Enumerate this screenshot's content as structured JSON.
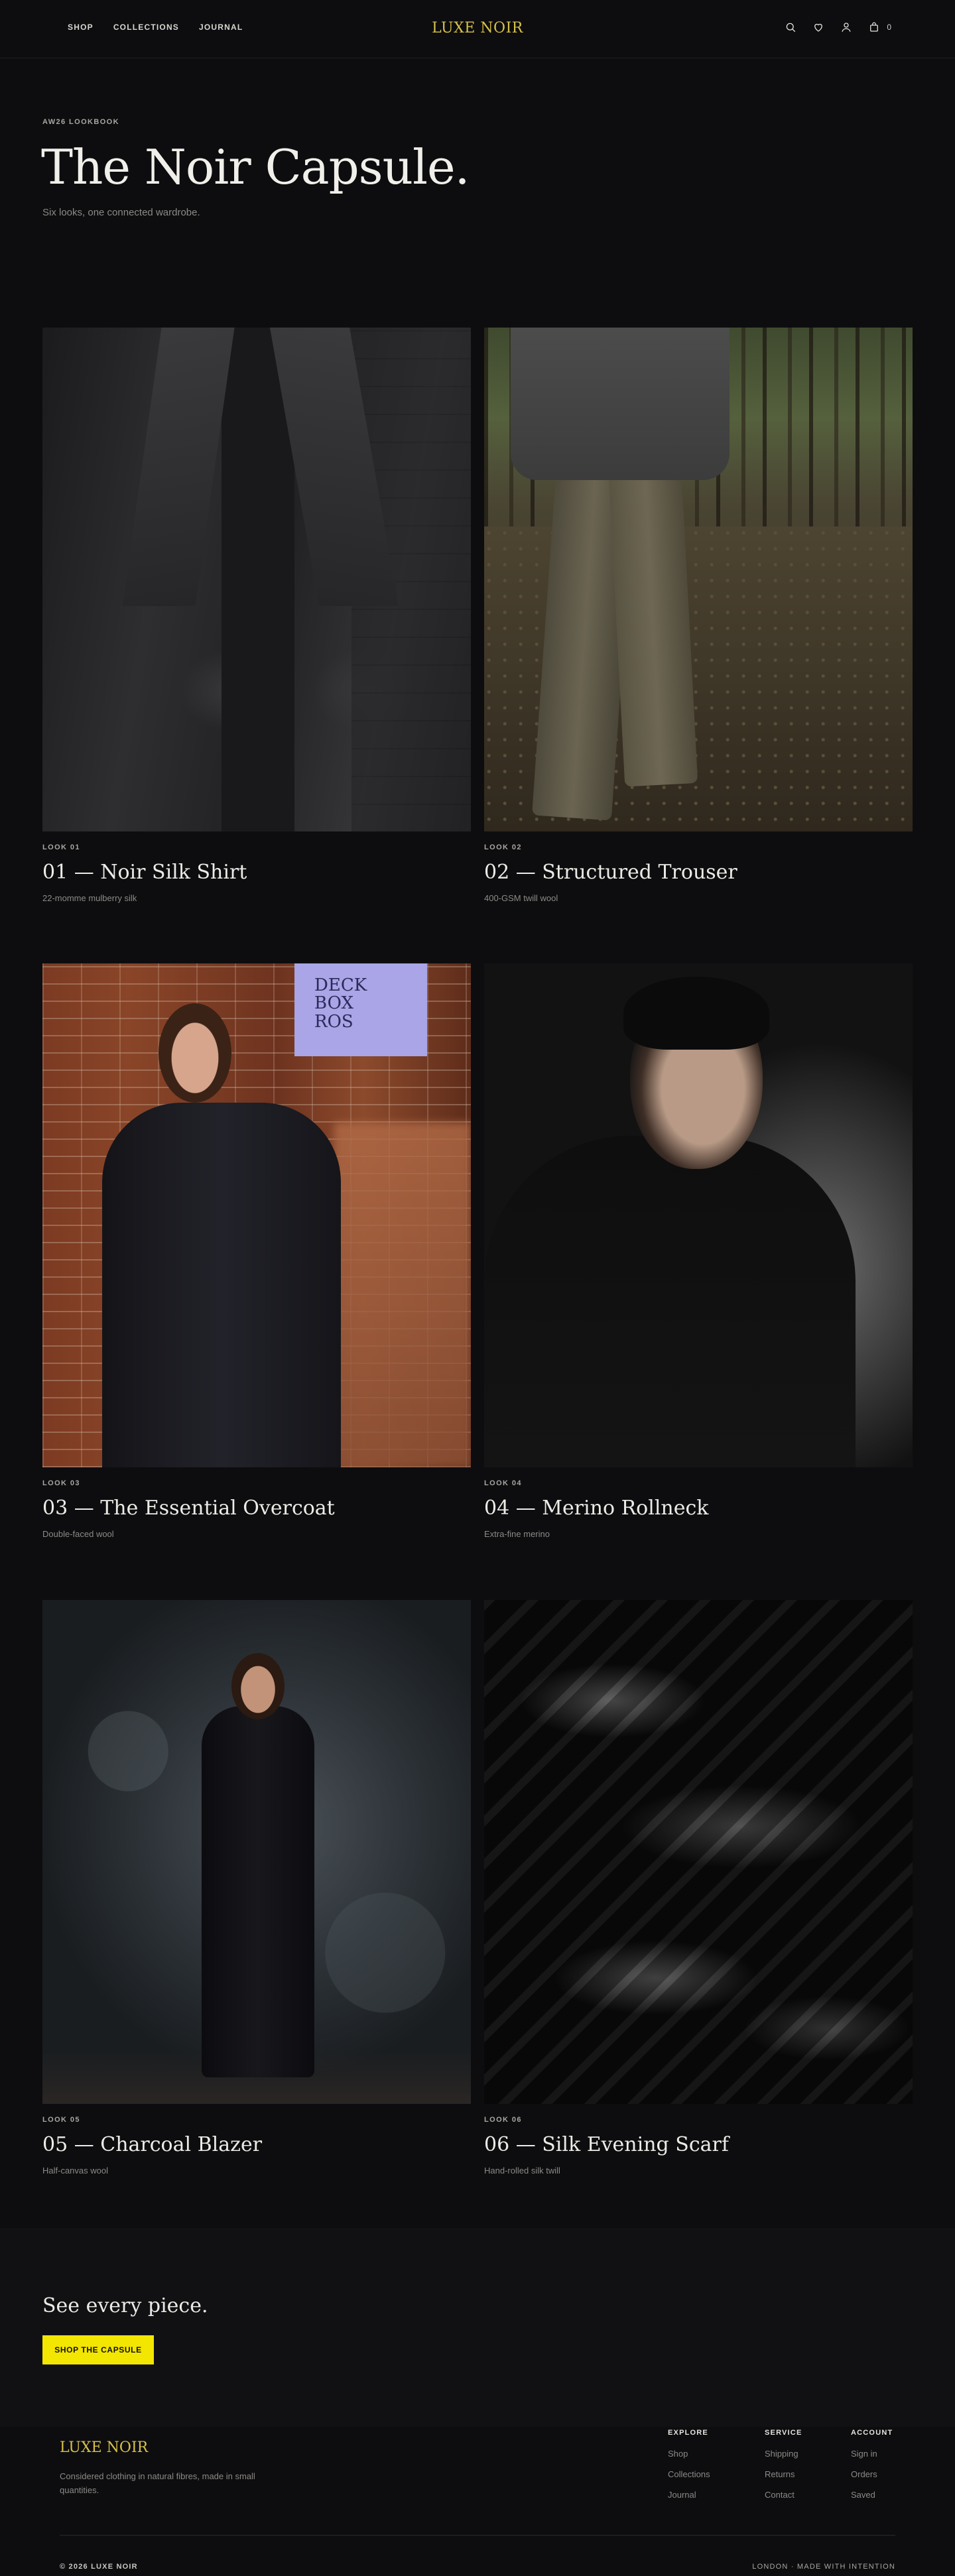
{
  "header": {
    "nav": [
      "SHOP",
      "COLLECTIONS",
      "JOURNAL"
    ],
    "logo": "LUXE NOIR",
    "bag_count": "0",
    "icons": [
      "search-icon",
      "heart-icon",
      "user-icon",
      "bag-icon"
    ]
  },
  "hero": {
    "eyebrow": "AW26 LOOKBOOK",
    "title": "The Noir Capsule.",
    "subtitle": "Six looks, one connected wardrobe."
  },
  "looks": [
    {
      "label": "LOOK 01",
      "name": "01 — Noir Silk Shirt",
      "desc": "22-momme mulberry silk"
    },
    {
      "label": "LOOK 02",
      "name": "02 — Structured Trouser",
      "desc": "400-GSM twill wool"
    },
    {
      "label": "LOOK 03",
      "name": "03 — The Essential Overcoat",
      "desc": "Double-faced wool"
    },
    {
      "label": "LOOK 04",
      "name": "04 — Merino Rollneck",
      "desc": "Extra-fine merino"
    },
    {
      "label": "LOOK 05",
      "name": "05 — Charcoal Blazer",
      "desc": "Half-canvas wool"
    },
    {
      "label": "LOOK 06",
      "name": "06 — Silk Evening Scarf",
      "desc": "Hand-rolled silk twill"
    }
  ],
  "cta": {
    "title": "See every piece.",
    "button": "SHOP THE CAPSULE"
  },
  "footer": {
    "logo": "LUXE NOIR",
    "tagline": "Considered clothing in natural fibres, made in small quantities.",
    "columns": [
      {
        "title": "EXPLORE",
        "links": [
          "Shop",
          "Collections",
          "Journal"
        ]
      },
      {
        "title": "SERVICE",
        "links": [
          "Shipping",
          "Returns",
          "Contact"
        ]
      },
      {
        "title": "ACCOUNT",
        "links": [
          "Sign in",
          "Orders",
          "Saved"
        ]
      }
    ],
    "copyright": "© 2026 LUXE NOIR",
    "right_text": "LONDON · MADE WITH INTENTION"
  },
  "colors": {
    "background": "#0d0d0f",
    "logo_gold": "#d7c04a",
    "cta_yellow": "#f3e600"
  }
}
